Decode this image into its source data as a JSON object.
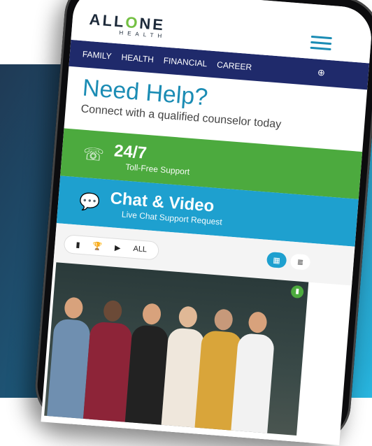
{
  "brand": {
    "logo_main_a": "ALL",
    "logo_main_o": "O",
    "logo_main_b": "NE",
    "logo_sub": "HEALTH"
  },
  "nav": {
    "items": [
      "FAMILY",
      "HEALTH",
      "FINANCIAL",
      "CAREER"
    ],
    "globe_icon": "globe-icon"
  },
  "help": {
    "title": "Need Help?",
    "subtitle": "Connect with a qualified counselor today"
  },
  "cards": [
    {
      "title": "24/7",
      "subtitle": "Toll-Free Support",
      "icon": "phone-icon",
      "color": "#4caa3e"
    },
    {
      "title": "Chat & Video",
      "subtitle": "Live Chat Support Request",
      "icon": "chat-icon",
      "color": "#1ea0cf"
    }
  ],
  "filters": {
    "all_label": "ALL",
    "icons": [
      "document-icon",
      "trophy-icon",
      "video-icon"
    ]
  },
  "colors": {
    "accent": "#1b8cb4",
    "nav_bg": "#1f2a6b",
    "green": "#4caa3e",
    "blue": "#1ea0cf"
  }
}
